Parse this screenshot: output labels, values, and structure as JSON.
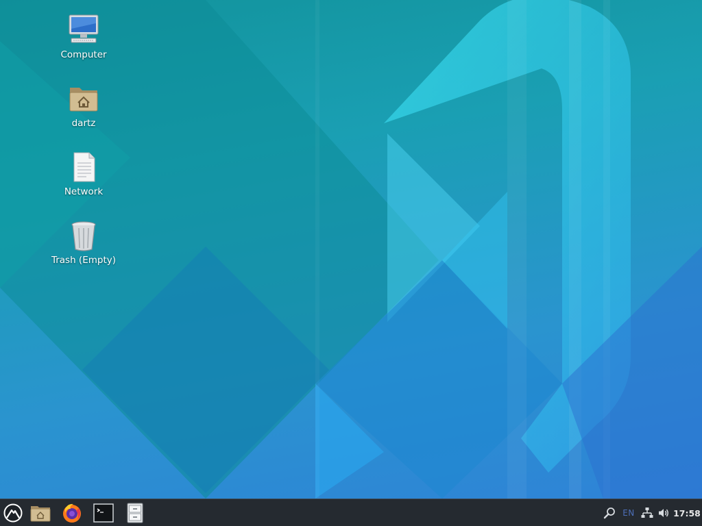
{
  "desktop": {
    "icons": [
      {
        "label": "Computer",
        "icon": "computer-icon"
      },
      {
        "label": "dartz",
        "icon": "home-folder-icon"
      },
      {
        "label": "Network",
        "icon": "document-icon"
      },
      {
        "label": "Trash (Empty)",
        "icon": "trash-icon"
      }
    ]
  },
  "panel": {
    "launchers": [
      {
        "name": "whisker-menu",
        "icon": "app-menu-icon"
      },
      {
        "name": "file-manager",
        "icon": "home-folder-icon"
      },
      {
        "name": "web-browser",
        "icon": "firefox-icon"
      },
      {
        "name": "terminal",
        "icon": "terminal-icon"
      },
      {
        "name": "file-cabinet",
        "icon": "file-cabinet-icon"
      }
    ],
    "tray": {
      "keyboard_layout": "EN",
      "clock": "17:58",
      "icons": [
        "search-icon",
        "network-icon",
        "volume-icon"
      ]
    }
  },
  "colors": {
    "wallpaper_teal": "#12939c",
    "wallpaper_blue": "#2f80d8",
    "panel_bg": "#252a30",
    "layout_indicator": "#4d6fb8"
  }
}
